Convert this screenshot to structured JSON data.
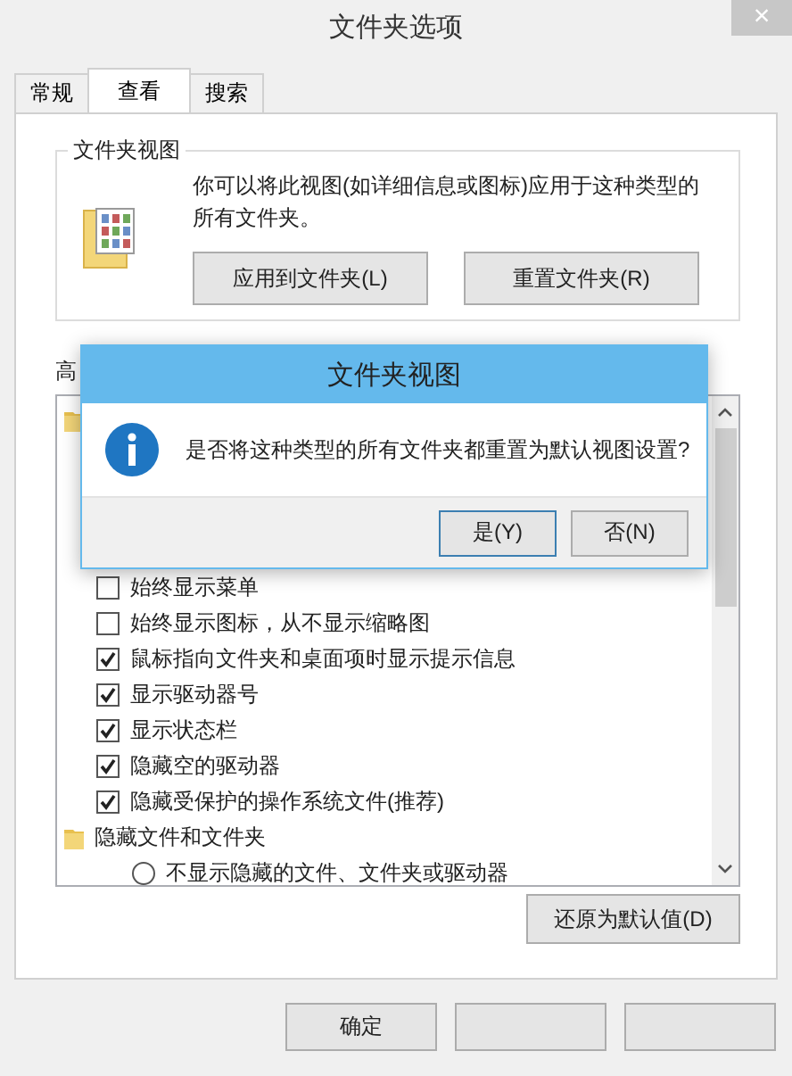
{
  "window": {
    "title": "文件夹选项",
    "close": "×"
  },
  "tabs": [
    {
      "label": "常规",
      "selected": false
    },
    {
      "label": "查看",
      "selected": true
    },
    {
      "label": "搜索",
      "selected": false
    }
  ],
  "folder_views": {
    "title": "文件夹视图",
    "description": "你可以将此视图(如详细信息或图标)应用于这种类型的所有文件夹。",
    "buttons": [
      "应用到文件夹(L)",
      "重置文件夹(R)"
    ]
  },
  "advanced": {
    "label": "高",
    "items": [
      {
        "kind": "folder"
      },
      {
        "kind": "checkbox",
        "label": "始终显示菜单",
        "checked": false
      },
      {
        "kind": "checkbox",
        "label": "始终显示图标，从不显示缩略图",
        "checked": false
      },
      {
        "kind": "checkbox",
        "label": "鼠标指向文件夹和桌面项时显示提示信息",
        "checked": true
      },
      {
        "kind": "checkbox",
        "label": "显示驱动器号",
        "checked": true
      },
      {
        "kind": "checkbox",
        "label": "显示状态栏",
        "checked": true
      },
      {
        "kind": "checkbox",
        "label": "隐藏空的驱动器",
        "checked": true
      },
      {
        "kind": "checkbox",
        "label": "隐藏受保护的操作系统文件(推荐)",
        "checked": true
      },
      {
        "kind": "folder",
        "label": "隐藏文件和文件夹"
      },
      {
        "kind": "radio",
        "label": "不显示隐藏的文件、文件夹或驱动器",
        "selected": false
      }
    ],
    "restore_button": "还原为默认值(D)"
  },
  "footer_buttons": [
    {
      "label": "确定"
    }
  ],
  "dialog": {
    "title": "文件夹视图",
    "message": "是否将这种类型的所有文件夹都重置为默认视图设置?",
    "buttons": [
      "是(Y)",
      "否(N)"
    ]
  }
}
